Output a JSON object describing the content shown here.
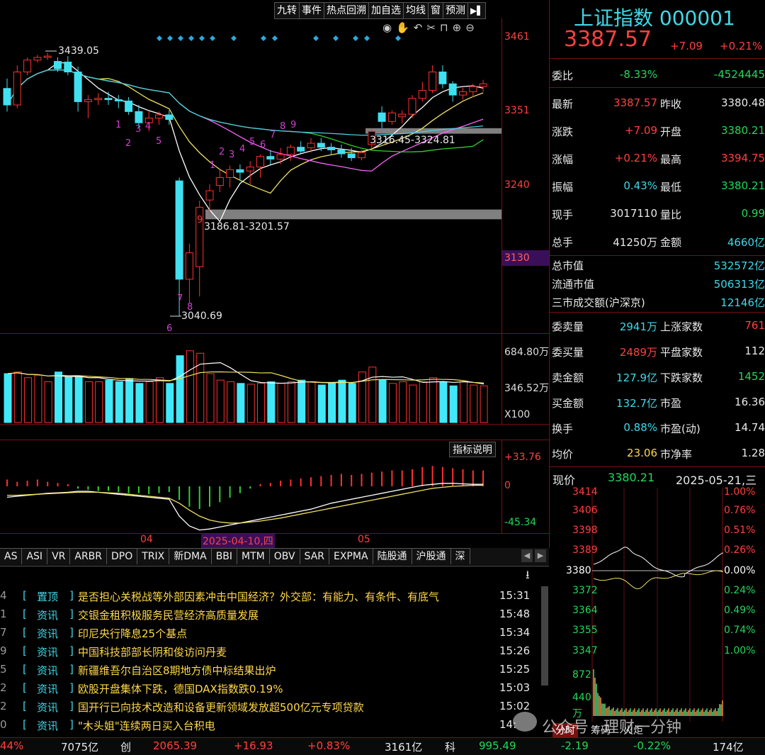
{
  "toolbar": [
    "九转",
    "事件",
    "热点回溯",
    "加自选",
    "均线",
    "窗",
    "预测"
  ],
  "tool_icons": [
    "eye-icon",
    "hand-icon",
    "undo-icon",
    "scissors-icon",
    "lock-icon",
    "zoom-in-icon",
    "zoom-out-icon"
  ],
  "main_chart": {
    "y_ticks": [
      "3461",
      "3351",
      "3240",
      "3130"
    ],
    "annotations": {
      "high": "3439.05",
      "low": "3040.69",
      "gap_upper": "3316.45-3324.81",
      "gap_lower": "3186.81-3201.57"
    },
    "nine_turn_numbers": [
      "1",
      "2",
      "3",
      "4",
      "5",
      "1",
      "2",
      "3",
      "4",
      "5",
      "6",
      "7",
      "8",
      "9",
      "9",
      "6",
      "7",
      "8"
    ],
    "volume_ticks": [
      "684.80万",
      "346.52万",
      "X100"
    ],
    "macd_ticks": [
      "+33.76",
      "0",
      "-45.34"
    ],
    "indicator_button": "指标说明",
    "x_ticks": [
      "04",
      "05"
    ],
    "cursor_date": "2025-04-10,四"
  },
  "chart_data": {
    "type": "candlestick",
    "ylim": [
      3040,
      3461
    ],
    "candles": [
      {
        "o": 3385,
        "h": 3400,
        "l": 3350,
        "c": 3360
      },
      {
        "o": 3360,
        "h": 3420,
        "l": 3355,
        "c": 3410
      },
      {
        "o": 3410,
        "h": 3432,
        "l": 3405,
        "c": 3428
      },
      {
        "o": 3428,
        "h": 3436,
        "l": 3424,
        "c": 3432
      },
      {
        "o": 3432,
        "h": 3439,
        "l": 3428,
        "c": 3434
      },
      {
        "o": 3426,
        "h": 3432,
        "l": 3410,
        "c": 3415
      },
      {
        "o": 3425,
        "h": 3434,
        "l": 3405,
        "c": 3410
      },
      {
        "o": 3410,
        "h": 3418,
        "l": 3350,
        "c": 3365
      },
      {
        "o": 3365,
        "h": 3375,
        "l": 3340,
        "c": 3368
      },
      {
        "o": 3368,
        "h": 3378,
        "l": 3360,
        "c": 3370
      },
      {
        "o": 3370,
        "h": 3380,
        "l": 3360,
        "c": 3368
      },
      {
        "o": 3368,
        "h": 3375,
        "l": 3355,
        "c": 3366
      },
      {
        "o": 3366,
        "h": 3372,
        "l": 3345,
        "c": 3350
      },
      {
        "o": 3350,
        "h": 3360,
        "l": 3325,
        "c": 3333
      },
      {
        "o": 3333,
        "h": 3350,
        "l": 3320,
        "c": 3340
      },
      {
        "o": 3340,
        "h": 3350,
        "l": 3330,
        "c": 3345
      },
      {
        "o": 3345,
        "h": 3352,
        "l": 3330,
        "c": 3338
      },
      {
        "o": 3245,
        "h": 3250,
        "l": 3040,
        "c": 3096
      },
      {
        "o": 3096,
        "h": 3150,
        "l": 3060,
        "c": 3136
      },
      {
        "o": 3115,
        "h": 3215,
        "l": 3070,
        "c": 3205
      },
      {
        "o": 3216,
        "h": 3240,
        "l": 3195,
        "c": 3230
      },
      {
        "o": 3238,
        "h": 3262,
        "l": 3228,
        "c": 3250
      },
      {
        "o": 3250,
        "h": 3268,
        "l": 3235,
        "c": 3262
      },
      {
        "o": 3262,
        "h": 3270,
        "l": 3245,
        "c": 3258
      },
      {
        "o": 3260,
        "h": 3275,
        "l": 3240,
        "c": 3266
      },
      {
        "o": 3266,
        "h": 3285,
        "l": 3250,
        "c": 3282
      },
      {
        "o": 3282,
        "h": 3292,
        "l": 3270,
        "c": 3278
      },
      {
        "o": 3278,
        "h": 3295,
        "l": 3270,
        "c": 3285
      },
      {
        "o": 3285,
        "h": 3300,
        "l": 3275,
        "c": 3296
      },
      {
        "o": 3296,
        "h": 3305,
        "l": 3285,
        "c": 3290
      },
      {
        "o": 3295,
        "h": 3310,
        "l": 3288,
        "c": 3302
      },
      {
        "o": 3302,
        "h": 3310,
        "l": 3290,
        "c": 3296
      },
      {
        "o": 3296,
        "h": 3302,
        "l": 3285,
        "c": 3292
      },
      {
        "o": 3292,
        "h": 3300,
        "l": 3280,
        "c": 3286
      },
      {
        "o": 3286,
        "h": 3295,
        "l": 3275,
        "c": 3280
      },
      {
        "o": 3280,
        "h": 3292,
        "l": 3276,
        "c": 3288
      },
      {
        "o": 3300,
        "h": 3325,
        "l": 3295,
        "c": 3320
      },
      {
        "o": 3348,
        "h": 3358,
        "l": 3325,
        "c": 3335
      },
      {
        "o": 3335,
        "h": 3352,
        "l": 3330,
        "c": 3348
      },
      {
        "o": 3342,
        "h": 3352,
        "l": 3332,
        "c": 3346
      },
      {
        "o": 3346,
        "h": 3375,
        "l": 3340,
        "c": 3370
      },
      {
        "o": 3370,
        "h": 3395,
        "l": 3365,
        "c": 3382
      },
      {
        "o": 3382,
        "h": 3420,
        "l": 3378,
        "c": 3410
      },
      {
        "o": 3410,
        "h": 3420,
        "l": 3385,
        "c": 3392
      },
      {
        "o": 3392,
        "h": 3396,
        "l": 3365,
        "c": 3375
      },
      {
        "o": 3375,
        "h": 3386,
        "l": 3368,
        "c": 3380
      },
      {
        "o": 3380,
        "h": 3392,
        "l": 3372,
        "c": 3388
      },
      {
        "o": 3388,
        "h": 3398,
        "l": 3380,
        "c": 3392
      }
    ]
  },
  "quote": {
    "title": "上证指数 000001",
    "price": "3387.57",
    "change": "+7.09",
    "change_pct": "+0.21%",
    "rows": [
      {
        "l1": "委比",
        "v1": "-8.33%",
        "l2": "",
        "v2": "-4524445"
      },
      {
        "l1": "最新",
        "v1": "3387.57",
        "l2": "昨收",
        "v2": "3380.48"
      },
      {
        "l1": "涨跌",
        "v1": "+7.09",
        "l2": "开盘",
        "v2": "3380.21"
      },
      {
        "l1": "涨幅",
        "v1": "+0.21%",
        "l2": "最高",
        "v2": "3394.75"
      },
      {
        "l1": "振幅",
        "v1": "0.43%",
        "l2": "最低",
        "v2": "3380.21"
      },
      {
        "l1": "现手",
        "v1": "3017110",
        "l2": "量比",
        "v2": "0.99"
      },
      {
        "l1": "总手",
        "v1": "41250万",
        "l2": "金额",
        "v2": "4660亿"
      }
    ],
    "market": [
      {
        "l": "总市值",
        "v": "532572亿"
      },
      {
        "l": "流通市值",
        "v": "506313亿"
      },
      {
        "l": "三市成交额(沪深京)",
        "v": "12146亿"
      }
    ],
    "rows2": [
      {
        "l1": "委卖量",
        "v1": "2941万",
        "l2": "上涨家数",
        "v2": "761"
      },
      {
        "l1": "委买量",
        "v1": "2489万",
        "l2": "平盘家数",
        "v2": "112"
      },
      {
        "l1": "卖金额",
        "v1": "127.9亿",
        "l2": "下跌家数",
        "v2": "1452"
      },
      {
        "l1": "买金额",
        "v1": "132.7亿",
        "l2": "市盈",
        "v2": "16.36"
      },
      {
        "l1": "换手",
        "v1": "0.88%",
        "l2": "市盈(动)",
        "v2": "14.74"
      },
      {
        "l1": "均价",
        "v1": "23.06",
        "l2": "市净率",
        "v2": "1.28"
      }
    ]
  },
  "mini": {
    "label": "现价",
    "price": "3380.21",
    "date": "2025-05-21,三",
    "left_ticks": [
      "3414",
      "3406",
      "3398",
      "3389",
      "3380",
      "3372",
      "3364",
      "3355",
      "3347",
      "872",
      "440",
      "万"
    ],
    "right_ticks": [
      "1.00%",
      "0.76%",
      "0.51%",
      "0.26%",
      "0.00%",
      "0.24%",
      "0.49%",
      "0.74%",
      "1.00%"
    ],
    "tabs": [
      "分时",
      "筹码",
      "火炬"
    ]
  },
  "tabs": [
    "AS",
    "ASI",
    "VR",
    "ARBR",
    "DPO",
    "TRIX",
    "新DMA",
    "BBI",
    "MTM",
    "OBV",
    "SAR",
    "EXPMA",
    "陆股通",
    "沪股通",
    "深"
  ],
  "news": [
    {
      "idx": "4",
      "tag": "置顶",
      "title": "是否担心关税战等外部因素冲击中国经济？外交部：有能力、有条件、有底气",
      "time": "15:31"
    },
    {
      "idx": "1",
      "tag": "资讯",
      "title": "交银金租积极服务民营经济高质量发展",
      "time": "15:48"
    },
    {
      "idx": "7",
      "tag": "资讯",
      "title": "印尼央行降息25个基点",
      "time": "15:34"
    },
    {
      "idx": "9",
      "tag": "资讯",
      "title": "中国科技部部长阴和俊访问丹麦",
      "time": "15:26"
    },
    {
      "idx": "5",
      "tag": "资讯",
      "title": "新疆维吾尔自治区8期地方债中标结果出炉",
      "time": "15:25"
    },
    {
      "idx": "2",
      "tag": "资讯",
      "title": "欧股开盘集体下跌，德国DAX指数跌0.19%",
      "time": "15:03"
    },
    {
      "idx": "2",
      "tag": "资讯",
      "title": "国开行已向技术改造和设备更新领域发放超500亿元专项贷款",
      "time": "15:02"
    },
    {
      "idx": "0",
      "tag": "资讯",
      "title": "\"木头姐\"连续两日买入台积电",
      "time": "14:"
    }
  ],
  "bottom": {
    "a1": "44%",
    "a2": "7075亿",
    "b0": "创",
    "b1": "2065.39",
    "b2": "+16.93",
    "b3": "+0.83%",
    "b4": "3161亿",
    "c0": "科",
    "c1": "995.49",
    "c2": "-2.19",
    "c3": "-0.22%",
    "c4": "174亿"
  },
  "watermark": "公众号 · 理财一分钟"
}
